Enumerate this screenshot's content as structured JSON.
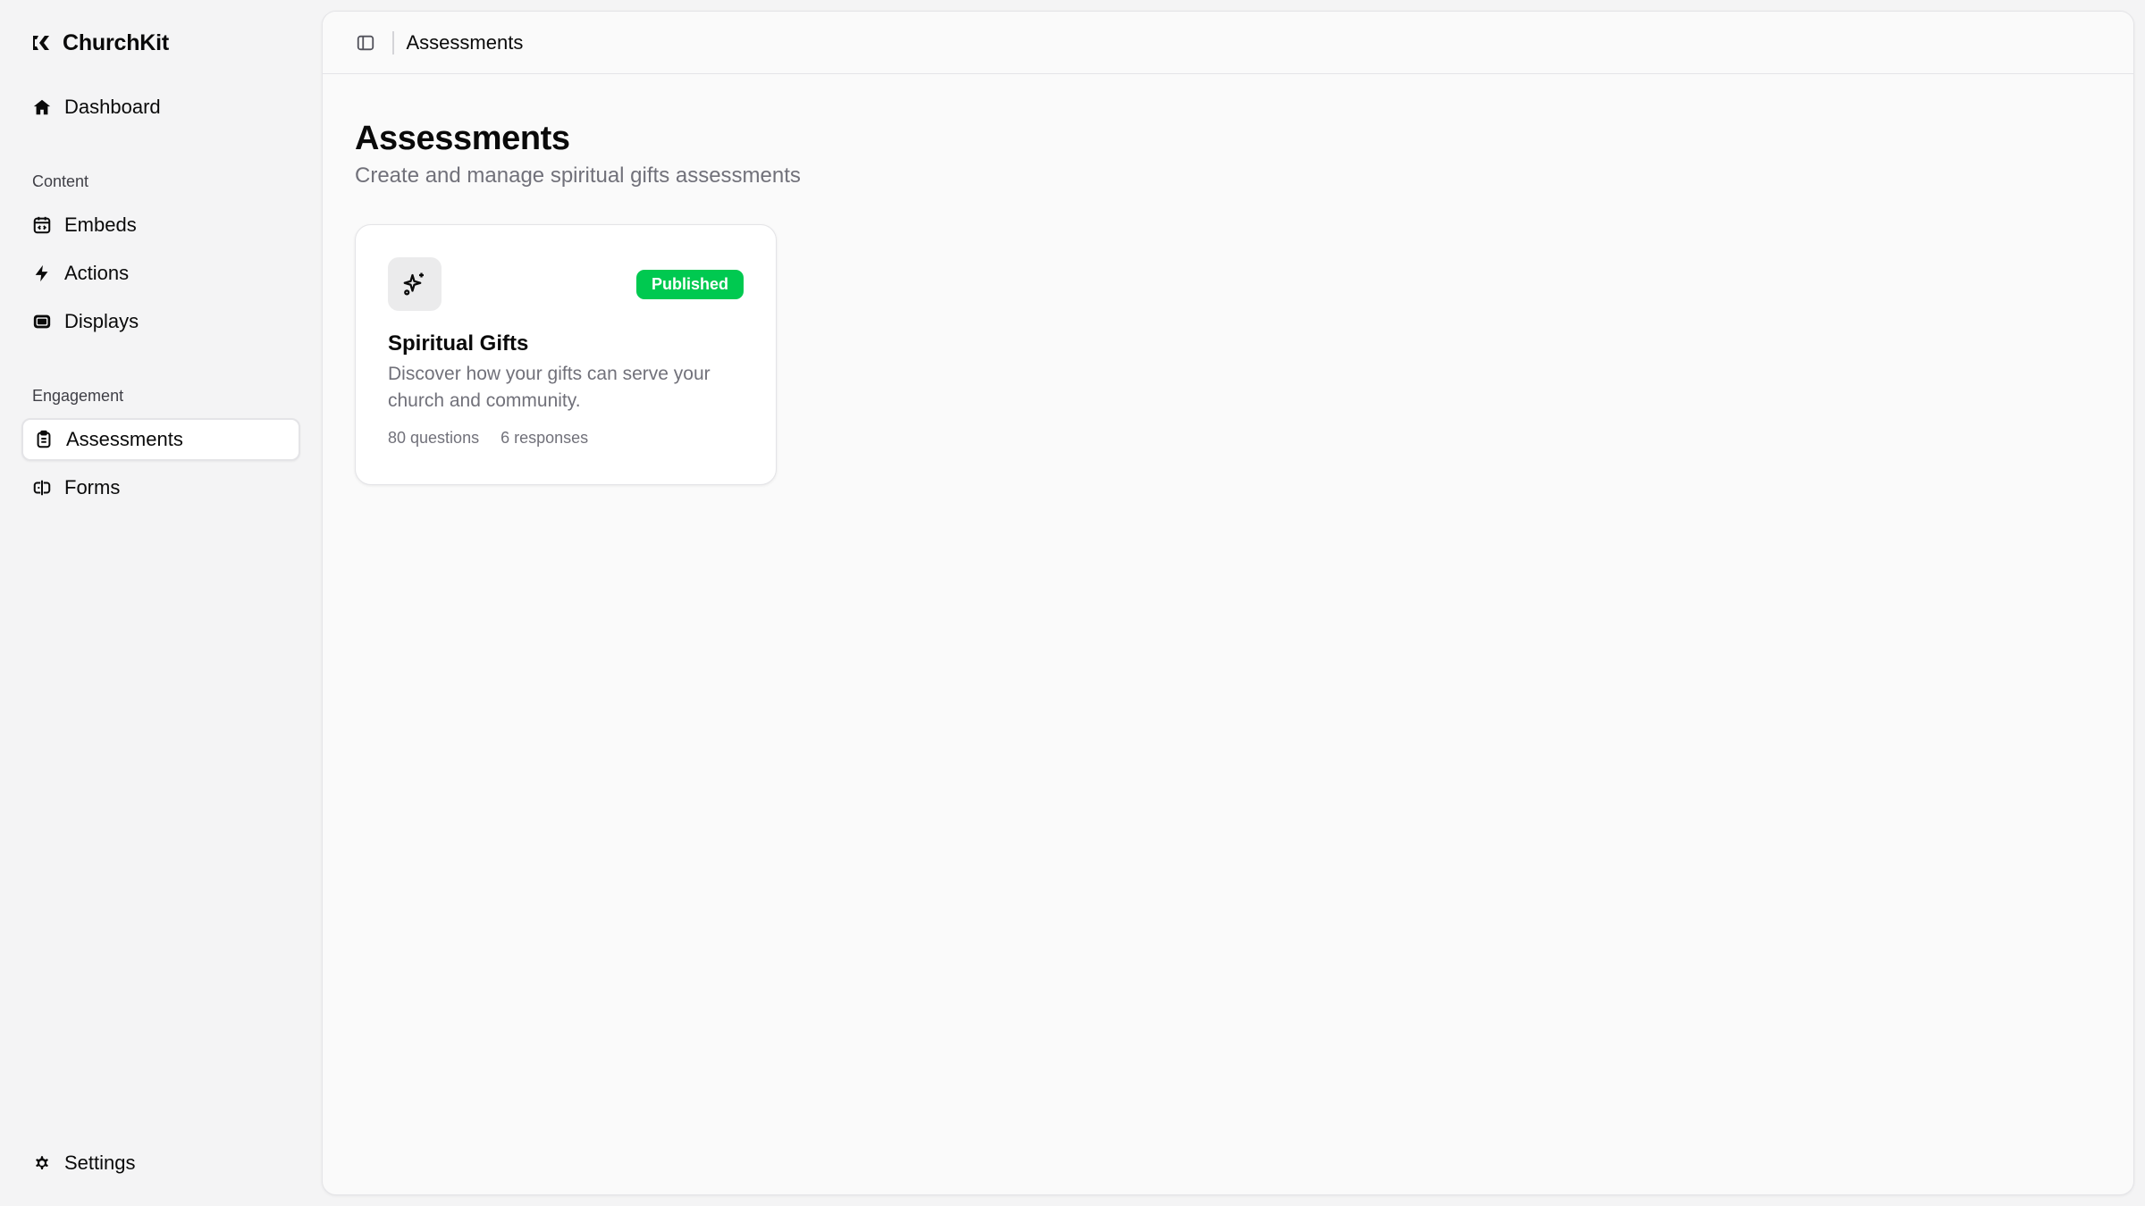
{
  "app": {
    "name": "ChurchKit"
  },
  "sidebar": {
    "dashboard": "Dashboard",
    "sections": {
      "content": "Content",
      "engagement": "Engagement"
    },
    "content_items": [
      "Embeds",
      "Actions",
      "Displays"
    ],
    "engagement_items": [
      "Assessments",
      "Forms"
    ],
    "active_item": "Assessments",
    "settings": "Settings"
  },
  "topbar": {
    "breadcrumb": "Assessments"
  },
  "page": {
    "title": "Assessments",
    "subtitle": "Create and manage spiritual gifts assessments"
  },
  "assessments": [
    {
      "title": "Spiritual Gifts",
      "description": "Discover how your gifts can serve your church and community.",
      "status": "Published",
      "questions": "80 questions",
      "responses": "6 responses",
      "icon": "sparkles-icon"
    }
  ],
  "colors": {
    "published_badge": "#00c950",
    "sidebar_bg": "#f4f4f5",
    "panel_bg": "#fafafa",
    "muted_text": "#71717a"
  }
}
